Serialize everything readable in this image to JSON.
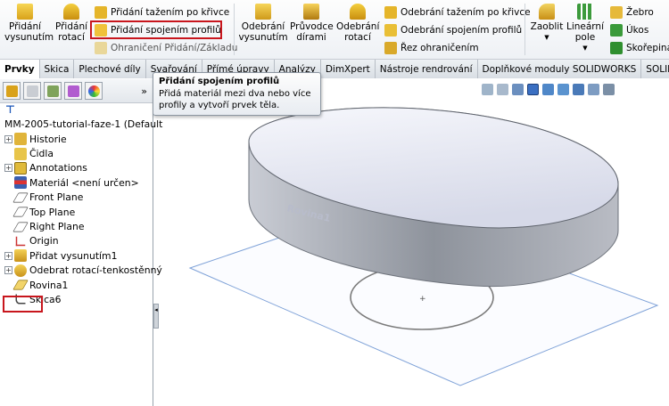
{
  "ribbon": {
    "pridani_vysunutim": "Přidání vysunutím",
    "pridani_rotaci": "Přidání rotací",
    "pridani_tazenim": "Přidání tažením po křivce",
    "pridani_spojenim": "Přidání spojením profilů",
    "ohraniceni_pridani": "Ohraničení Přidání/Základu",
    "odebrani_vysunutim": "Odebrání vysunutím",
    "pruvodce_dirami": "Průvodce dírami",
    "odebrani_rotaci": "Odebrání rotací",
    "odebrani_tazenim": "Odebrání tažením po křivce",
    "odebrani_spojenim": "Odebrání spojením profilů",
    "rez_ohranicenim": "Řez ohraničením",
    "zaoblit": "Zaoblit",
    "linearni_pole": "Lineární pole",
    "zebro": "Žebro",
    "ukos": "Úkos",
    "skorepina": "Skořepina"
  },
  "tabs": [
    "Prvky",
    "Skica",
    "Plechové díly",
    "Svařování",
    "Přímé úpravy",
    "Analýzy",
    "DimXpert",
    "Nástroje rendrování",
    "Doplňkové moduly SOLIDWORKS",
    "SOLID"
  ],
  "tooltip": {
    "title": "Přidání spojením profilů",
    "body": "Přidá materiál mezi dva nebo více profily a vytvoří prvek těla."
  },
  "tree": {
    "root": "MM-2005-tutorial-faze-1  (Default",
    "items": [
      {
        "label": "Historie",
        "icon": "history-icon",
        "expand": "+"
      },
      {
        "label": "Čidla",
        "icon": "sensor-icon",
        "expand": ""
      },
      {
        "label": "Annotations",
        "icon": "annotations-icon",
        "expand": "+"
      },
      {
        "label": "Materiál <není určen>",
        "icon": "material-icon",
        "expand": ""
      },
      {
        "label": "Front Plane",
        "icon": "plane-icon",
        "expand": ""
      },
      {
        "label": "Top Plane",
        "icon": "plane-icon",
        "expand": ""
      },
      {
        "label": "Right Plane",
        "icon": "plane-icon",
        "expand": ""
      },
      {
        "label": "Origin",
        "icon": "origin-icon",
        "expand": ""
      },
      {
        "label": "Přidat vysunutím1",
        "icon": "extrude-icon",
        "expand": "+"
      },
      {
        "label": "Odebrat rotací-tenkostěnný",
        "icon": "revolve-cut-icon",
        "expand": "+"
      },
      {
        "label": "Rovina1",
        "icon": "plane-icon",
        "expand": ""
      },
      {
        "label": "Skica6",
        "icon": "sketch-icon",
        "expand": ""
      }
    ]
  },
  "viewport": {
    "plane_label": "Rovina1"
  },
  "colors": {
    "accent_red": "#c8161d",
    "ribbon_bg": "#eef1f5",
    "body_gray": "#a7abb3",
    "top_face": "#e4e6f2"
  }
}
